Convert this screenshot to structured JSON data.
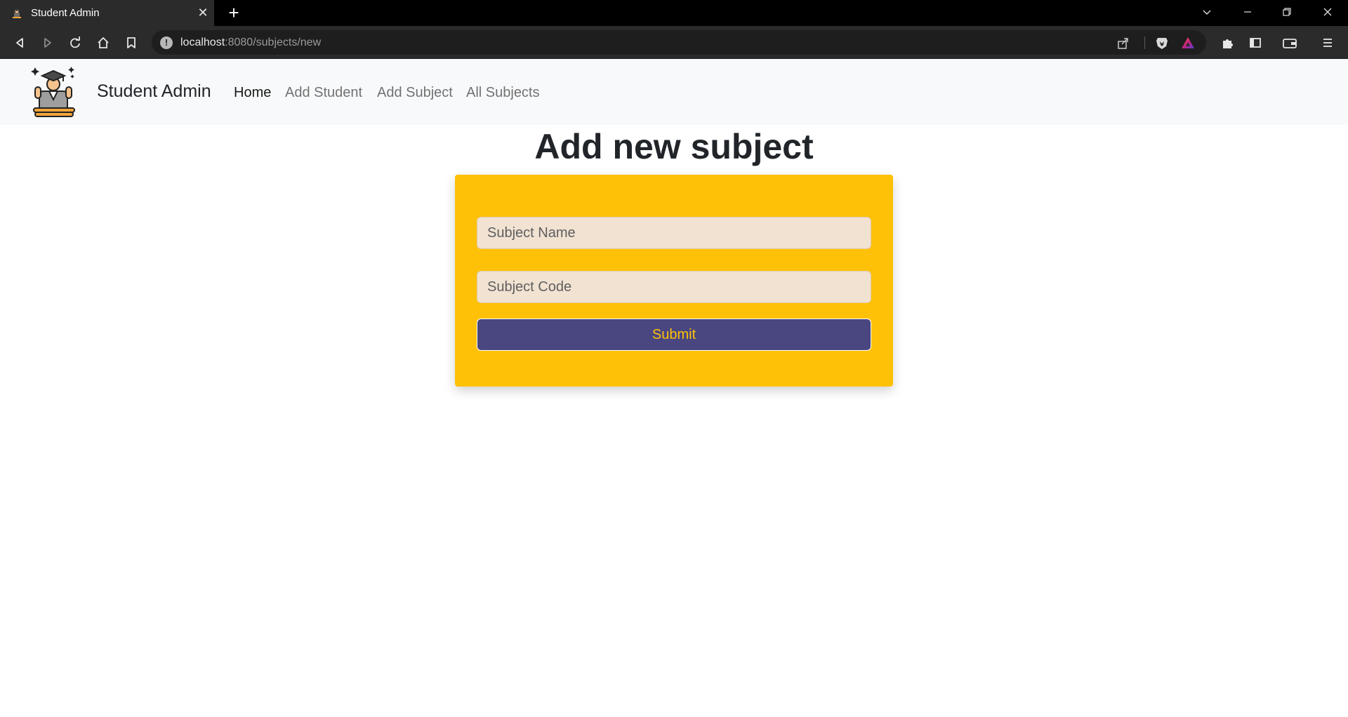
{
  "browser": {
    "tab_title": "Student Admin",
    "url_host": "localhost",
    "url_path": ":8080/subjects/new"
  },
  "navbar": {
    "brand": "Student Admin",
    "links": [
      {
        "label": "Home",
        "active": true
      },
      {
        "label": "Add Student",
        "active": false
      },
      {
        "label": "Add Subject",
        "active": false
      },
      {
        "label": "All Subjects",
        "active": false
      }
    ]
  },
  "main": {
    "title": "Add new subject",
    "form": {
      "subject_name_placeholder": "Subject Name",
      "subject_name_value": "",
      "subject_code_placeholder": "Subject Code",
      "subject_code_value": "",
      "submit_label": "Submit"
    }
  },
  "colors": {
    "card_background": "#ffc107",
    "button_background": "#4a4680",
    "button_text": "#ffc107",
    "input_background": "#f1e2d2",
    "navbar_background": "#f8f9fa"
  },
  "icons": {
    "tab_favicon": "graduate-icon",
    "back": "back-arrow-icon",
    "forward": "forward-arrow-icon",
    "reload": "reload-icon",
    "home": "home-icon",
    "bookmark": "bookmark-icon",
    "site_info": "info-icon",
    "share": "share-icon",
    "brave_shields": "brave-lion-icon",
    "rewards": "rewards-triangle-icon",
    "extensions": "puzzle-icon",
    "sidebar": "sidebar-icon",
    "wallet": "wallet-icon",
    "menu": "hamburger-menu-icon",
    "brand_logo": "graduate-student-logo"
  }
}
